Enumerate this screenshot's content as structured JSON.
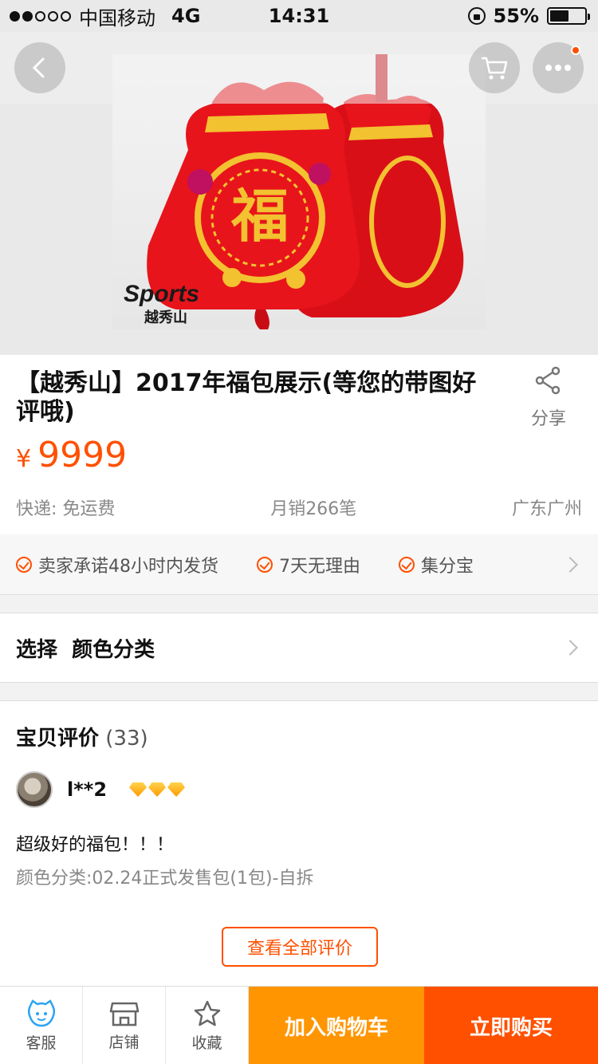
{
  "status": {
    "carrier": "中国移动",
    "network": "4G",
    "time": "14:31",
    "battery_text": "55%",
    "battery_level": 0.55,
    "signal_bars_filled": 2,
    "signal_bars_total": 5
  },
  "nav": {
    "back_icon": "chevron-left-icon",
    "cart_icon": "cart-icon",
    "more_icon": "more-icon"
  },
  "hero": {
    "watermark_brand": "Sports",
    "watermark_sub": "越秀山",
    "bag_char": "福"
  },
  "product": {
    "title": "【越秀山】2017年福包展示(等您的带图好评哦)",
    "share_label": "分享",
    "currency": "¥",
    "price": "9999",
    "shipping": "快递: 免运费",
    "monthly_sales": "月销266笔",
    "location": "广东广州"
  },
  "guarantees": [
    "卖家承诺48小时内发货",
    "7天无理由",
    "集分宝"
  ],
  "select": {
    "label": "选择  颜色分类"
  },
  "reviews": {
    "heading": "宝贝评价",
    "count": "(33)",
    "username": "l**2",
    "text": "超级好的福包！！！",
    "sku": "颜色分类:02.24正式发售包(1包)-自拆",
    "view_all": "查看全部评价"
  },
  "bottom": {
    "service_label": "客服",
    "shop_label": "店铺",
    "fav_label": "收藏",
    "cart_label": "加入购物车",
    "buy_label": "立即购买"
  },
  "colors": {
    "accent": "#ff5000",
    "cart_orange": "#ff9500",
    "bag_red": "#e8141b",
    "gold": "#f2c230"
  }
}
